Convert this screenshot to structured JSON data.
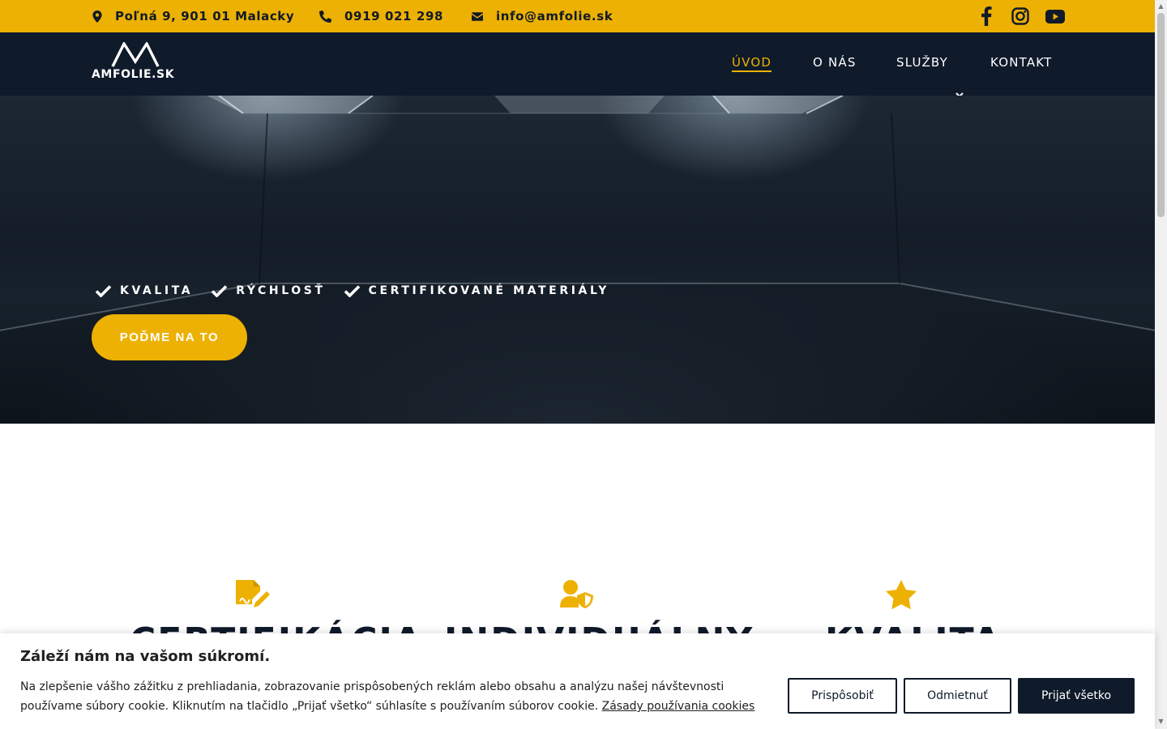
{
  "topbar": {
    "address": "Poľná 9, 901 01 Malacky",
    "phone": "0919 021 298",
    "email": "info@amfolie.sk",
    "icons": [
      "map-marker-icon",
      "phone-icon",
      "envelope-icon",
      "facebook-icon",
      "instagram-icon",
      "youtube-icon"
    ]
  },
  "nav": {
    "logo_text": "AMFOLIE.SK",
    "items": [
      {
        "label": "ÚVOD",
        "active": true
      },
      {
        "label": "O NÁS",
        "active": false
      },
      {
        "label": "SLUŽBY",
        "active": false,
        "has_dropdown": true
      },
      {
        "label": "KONTAKT",
        "active": false
      }
    ]
  },
  "hero": {
    "features": [
      "KVALITA",
      "RÝCHLOSŤ",
      "CERTIFIKOVANÉ MATERIÁLY"
    ],
    "cta": "POĎME NA TO"
  },
  "highlights": {
    "icons": [
      "signature-document-icon",
      "user-shield-icon",
      "star-icon"
    ],
    "titles": [
      "CERTIFIKÁCIA",
      "INDIVIDUÁLNY",
      "KVALITA"
    ]
  },
  "cookie": {
    "title": "Záleží nám na vašom súkromí.",
    "text": "Na zlepšenie vášho zážitku z prehliadania, zobrazovanie prispôsobených reklám alebo obsahu a analýzu našej návštevnosti používame súbory cookie. Kliknutím na tlačidlo „Prijať všetko“ súhlasíte s používaním súborov cookie.",
    "link": "Zásady používania cookies",
    "buttons": {
      "customize": "Prispôsobiť",
      "reject": "Odmietnuť",
      "accept": "Prijať všetko"
    }
  },
  "colors": {
    "accent": "#EDB103",
    "navy": "#0f1a2a"
  }
}
